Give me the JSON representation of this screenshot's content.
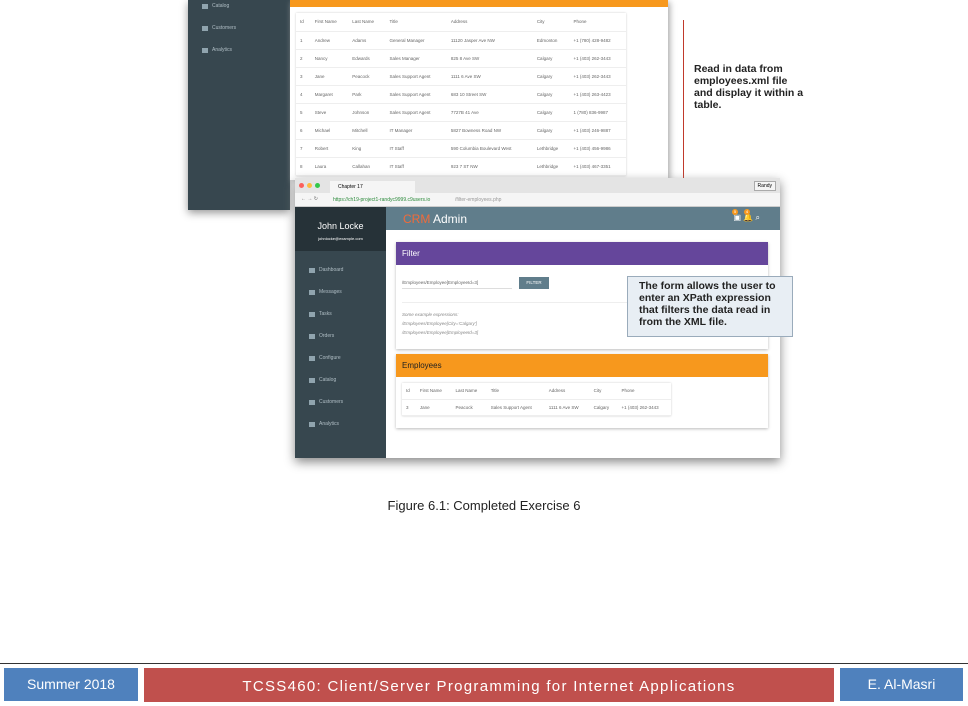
{
  "back_window": {
    "sidebar": [
      "Catalog",
      "Customers",
      "Analytics"
    ],
    "table": {
      "headers": [
        "Id",
        "First Name",
        "Last Name",
        "Title",
        "Address",
        "City",
        "Phone"
      ],
      "rows": [
        [
          "1",
          "Andrew",
          "Adams",
          "General Manager",
          "11120 Jasper Ave NW",
          "Edmonton",
          "+1 (780) 428-9482"
        ],
        [
          "2",
          "Nancy",
          "Edwards",
          "Sales Manager",
          "825 8 Ave SW",
          "Calgary",
          "+1 (403) 262-3443"
        ],
        [
          "3",
          "Jane",
          "Peacock",
          "Sales Support Agent",
          "1111 6 Ave SW",
          "Calgary",
          "+1 (403) 262-3443"
        ],
        [
          "4",
          "Margaret",
          "Park",
          "Sales Support Agent",
          "683 10 Street SW",
          "Calgary",
          "+1 (403) 263-4423"
        ],
        [
          "5",
          "Steve",
          "Johnson",
          "Sales Support Agent",
          "7727B 41 Ave",
          "Calgary",
          "1 (780) 836-9987"
        ],
        [
          "6",
          "Michael",
          "Mitchell",
          "IT Manager",
          "5827 Bowness Road NW",
          "Calgary",
          "+1 (403) 246-9887"
        ],
        [
          "7",
          "Robert",
          "King",
          "IT Staff",
          "590 Columbia Boulevard West",
          "Lethbridge",
          "+1 (403) 456-9986"
        ],
        [
          "8",
          "Laura",
          "Callahan",
          "IT Staff",
          "923 7 ST NW",
          "Lethbridge",
          "+1 (403) 467-3351"
        ]
      ]
    }
  },
  "annotation_top": "Read in data from employees.xml file and display it within a table.",
  "front_window": {
    "tab": "Chapter 17",
    "user_badge": "Randy",
    "url_host": "https://ch19-project1-randyc9999.c9users.io",
    "url_path": "/filter-employees.php",
    "user_name": "John Locke",
    "user_email": "johnlocke@example.com",
    "brand_accent": "CRM",
    "brand_rest": " Admin",
    "notif_counts": [
      "5",
      "4"
    ],
    "sidebar": [
      "Dashboard",
      "Messages",
      "Tasks",
      "Orders",
      "Configure",
      "Catalog",
      "Customers",
      "Analytics"
    ],
    "filter": {
      "title": "Filter",
      "input": "/Employees/Employee[EmployeeId=3]",
      "button": "FILTER",
      "help": [
        "Some example expressions:",
        "/Employees/Employee[City='Calgary']",
        "/Employees/Employee[EmployeeId=3]"
      ]
    },
    "employees": {
      "title": "Employees",
      "headers": [
        "Id",
        "First Name",
        "Last Name",
        "Title",
        "Address",
        "City",
        "Phone"
      ],
      "rows": [
        [
          "3",
          "Jane",
          "Peacock",
          "Sales Support Agent",
          "1111 6 Ave SW",
          "Calgary",
          "+1 (403) 262-3443"
        ]
      ]
    }
  },
  "callout": "The form allows the user to enter an XPath expression that filters the data read in from the XML file.",
  "caption": "Figure 6.1: Completed Exercise 6",
  "footer": {
    "left": "Summer 2018",
    "center": "TCSS460: Client/Server Programming for Internet Applications",
    "right": "E. Al-Masri"
  },
  "colors": {
    "purple": "#65469b",
    "orange": "#f7981d",
    "header": "#607d8b",
    "accent": "#f26b3a",
    "footer_blue": "#4f81bd",
    "footer_red": "#c0504d"
  }
}
